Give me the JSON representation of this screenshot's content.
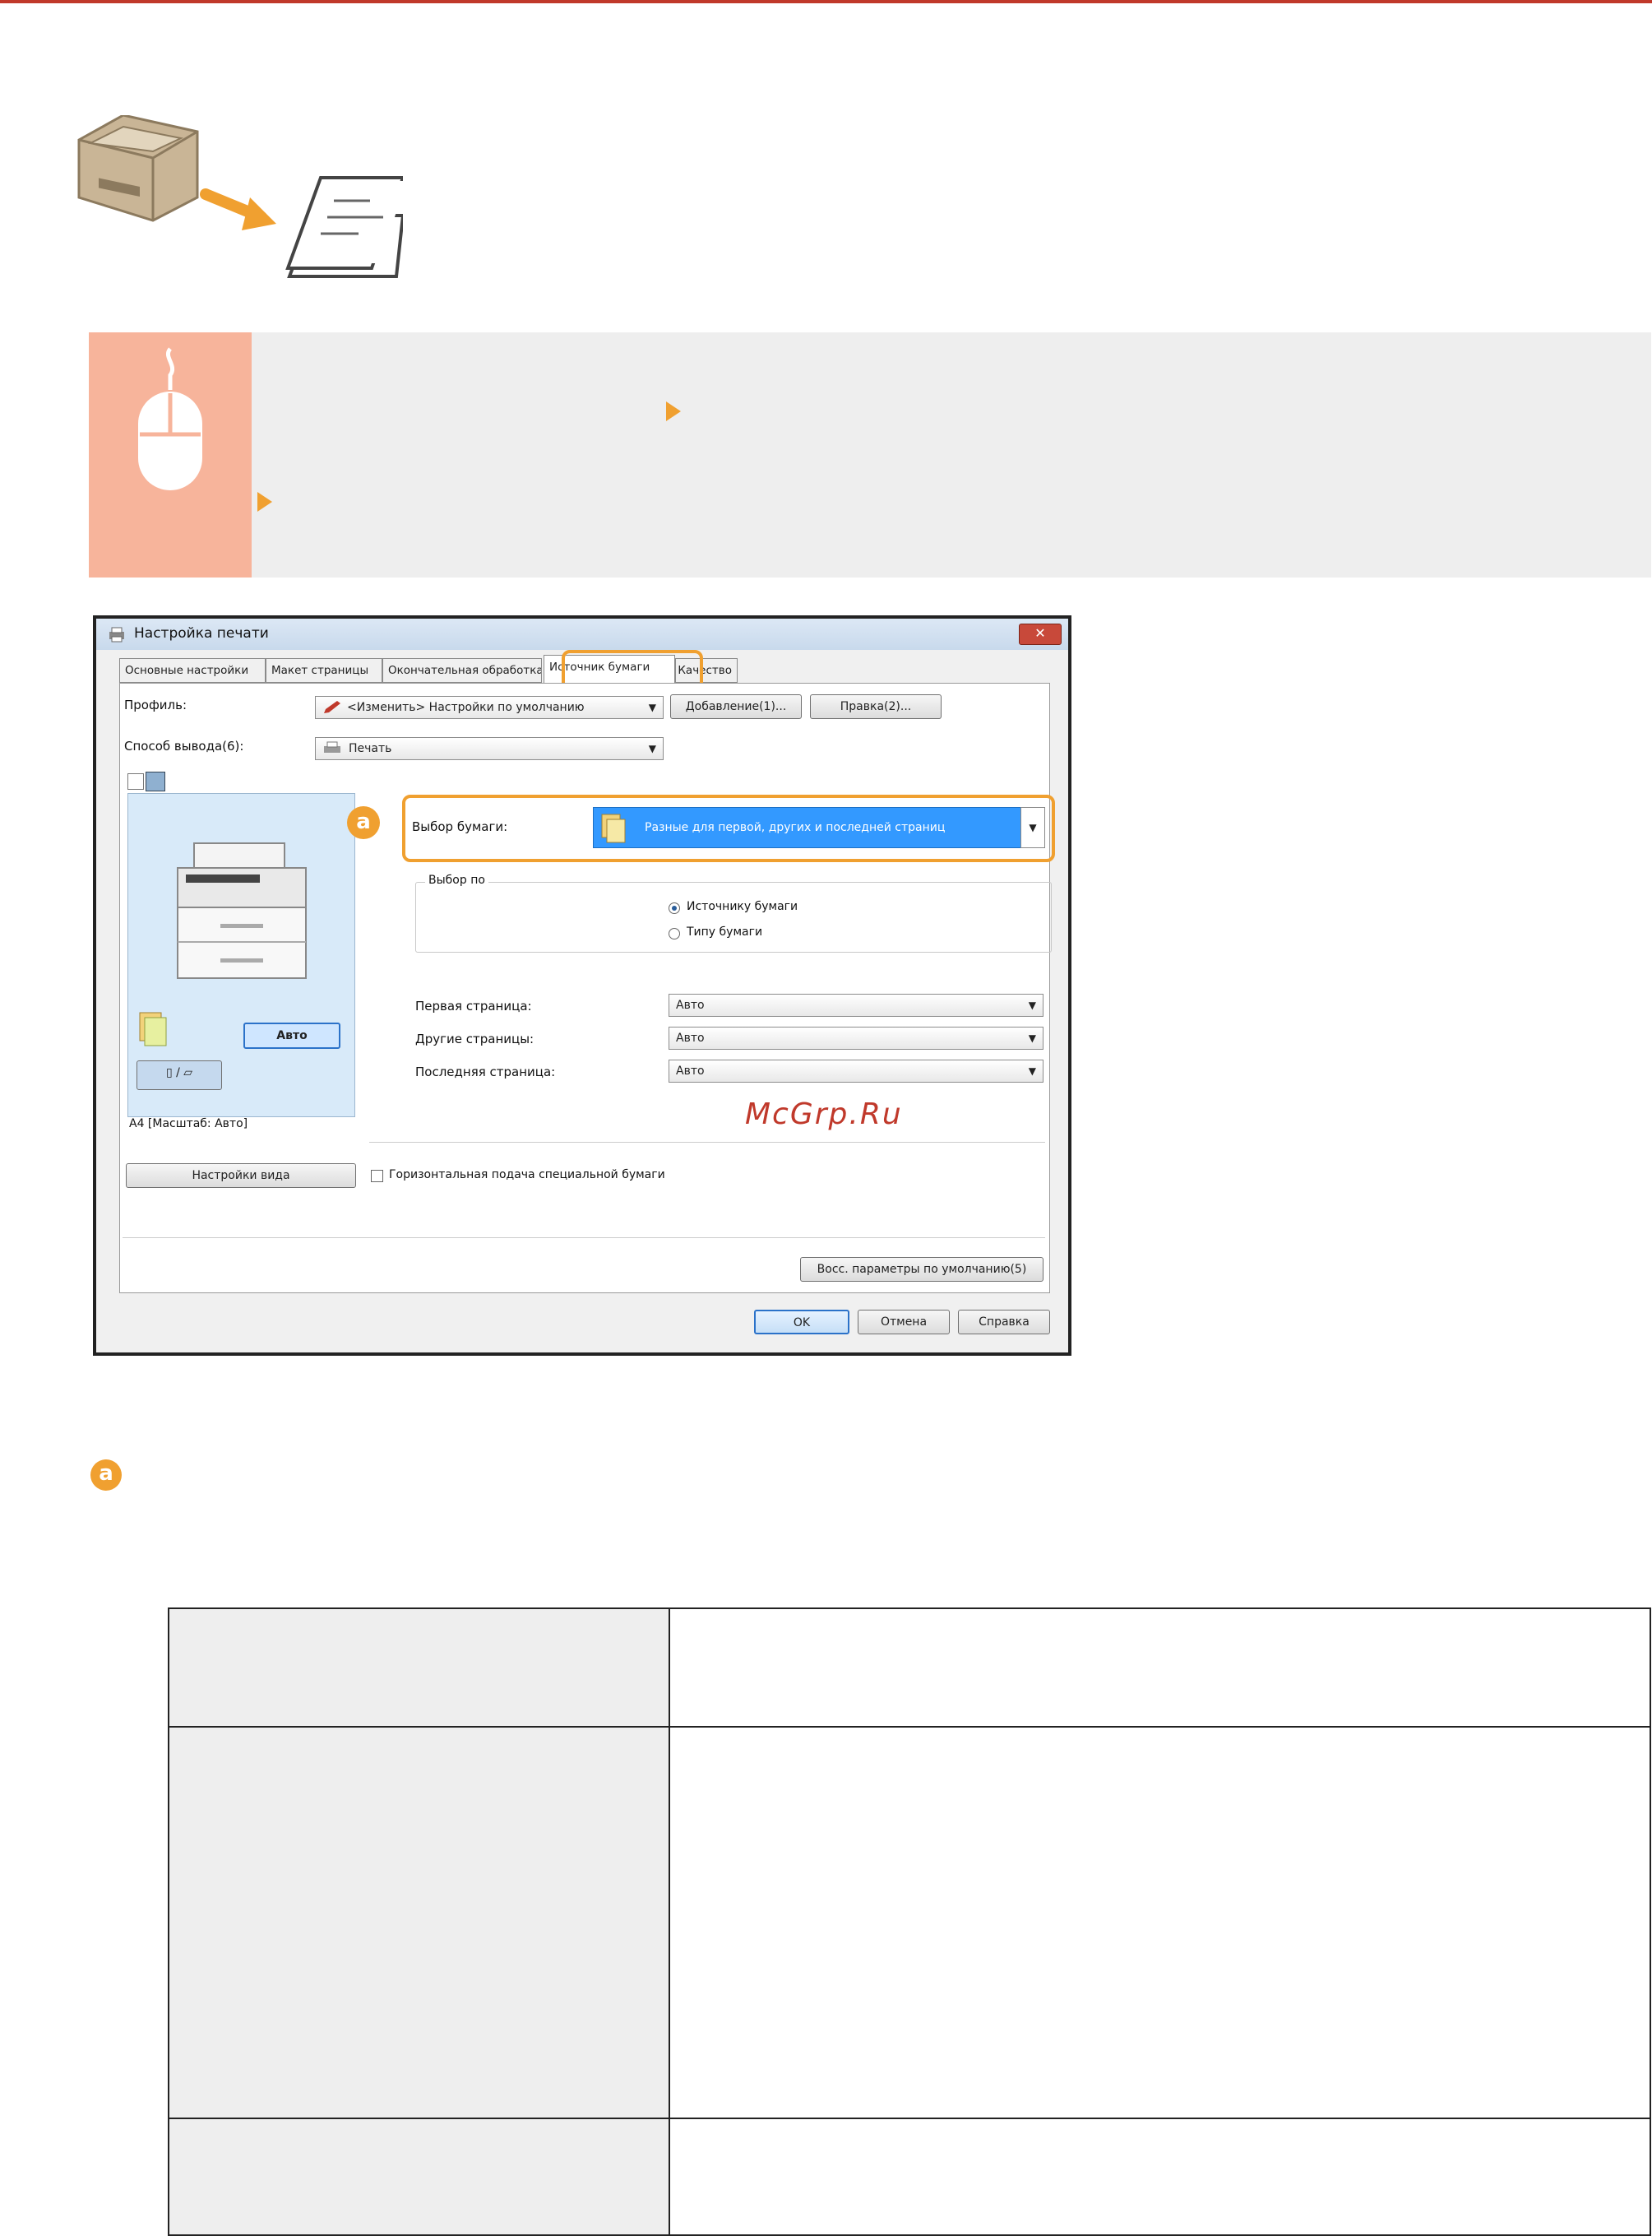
{
  "dialog": {
    "title": "Настройка печати",
    "close": "✕",
    "tabs": [
      "Основные настройки",
      "Макет страницы",
      "Окончательная обработка",
      "Источник бумаги",
      "Качество"
    ],
    "profile_label": "Профиль:",
    "profile_value": "<Изменить> Настройки по умолчанию",
    "add_button": "Добавление(1)...",
    "edit_button": "Правка(2)...",
    "output_label": "Способ вывода(6):",
    "output_value": "Печать",
    "badge": "a",
    "paper_select_label": "Выбор бумаги:",
    "paper_select_value": "Разные для первой, других и последней страниц",
    "group_title": "Выбор по",
    "radio_source": "Источнику бумаги",
    "radio_type": "Типу бумаги",
    "first_page_label": "Первая страница:",
    "first_page_value": "Авто",
    "other_pages_label": "Другие страницы:",
    "other_pages_value": "Авто",
    "last_page_label": "Последняя страница:",
    "last_page_value": "Авто",
    "preview_auto": "Авто",
    "preview_caption": "A4 [Масштаб: Авто]",
    "view_settings_button": "Настройки вида",
    "horizontal_feed_label": "Горизонтальная подача специальной бумаги",
    "restore_defaults_button": "Восс. параметры по умолчанию(5)",
    "ok_button": "OK",
    "cancel_button": "Отмена",
    "help_button": "Справка"
  },
  "watermark": "McGrp.Ru",
  "section_badge": "a",
  "colors": {
    "accent": "#f0a030",
    "topline": "#c0392b",
    "note_side": "#f7b49b",
    "selection": "#3399ff"
  }
}
